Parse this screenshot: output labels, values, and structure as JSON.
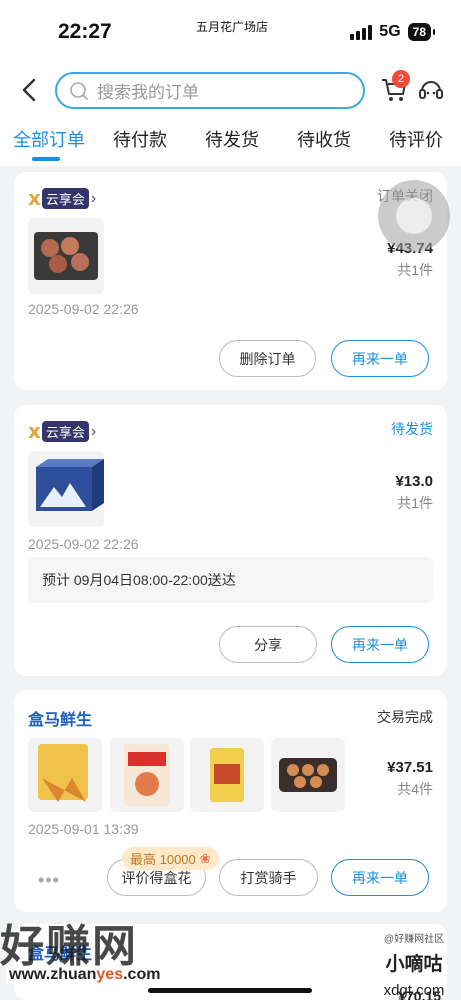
{
  "status_bar": {
    "time": "22:27",
    "location": "五月花广场店",
    "network": "5G",
    "battery": "78"
  },
  "header": {
    "search_placeholder": "搜索我的订单",
    "cart_count": "2"
  },
  "tabs": [
    "全部订单",
    "待付款",
    "待发货",
    "待收货",
    "待评价"
  ],
  "orders": [
    {
      "store": "云享会",
      "status": "订单关闭",
      "price": "¥43.74",
      "qty": "共1件",
      "time": "2025-09-02 22:26",
      "buttons": [
        "删除订单",
        "再来一单"
      ]
    },
    {
      "store": "云享会",
      "status": "待发货",
      "price": "¥13.0",
      "qty": "共1件",
      "time": "2025-09-02 22:26",
      "delivery": "预计 09月04日08:00-22:00送达",
      "buttons": [
        "分享",
        "再来一单"
      ]
    },
    {
      "store": "盒马鲜生",
      "status": "交易完成",
      "price": "¥37.51",
      "qty": "共4件",
      "time": "2025-09-01 13:39",
      "promo": "最高 10000",
      "buttons": [
        "评价得盒花",
        "打赏骑手",
        "再来一单"
      ]
    }
  ],
  "partial_order": {
    "store": "盒马鲜生",
    "price": "¥70.15"
  },
  "watermark": {
    "big": "好赚网",
    "url_prefix": "www.zhuan",
    "url_mid": "yes",
    "url_suffix": ".com",
    "right_top": "@好赚网社区",
    "right_mid": "小嘀咕",
    "right_bottom": "xdgt.com"
  },
  "colors": {
    "accent": "#1a8fe0",
    "badge": "#f04a3a",
    "hema": "#1e5fbf"
  }
}
